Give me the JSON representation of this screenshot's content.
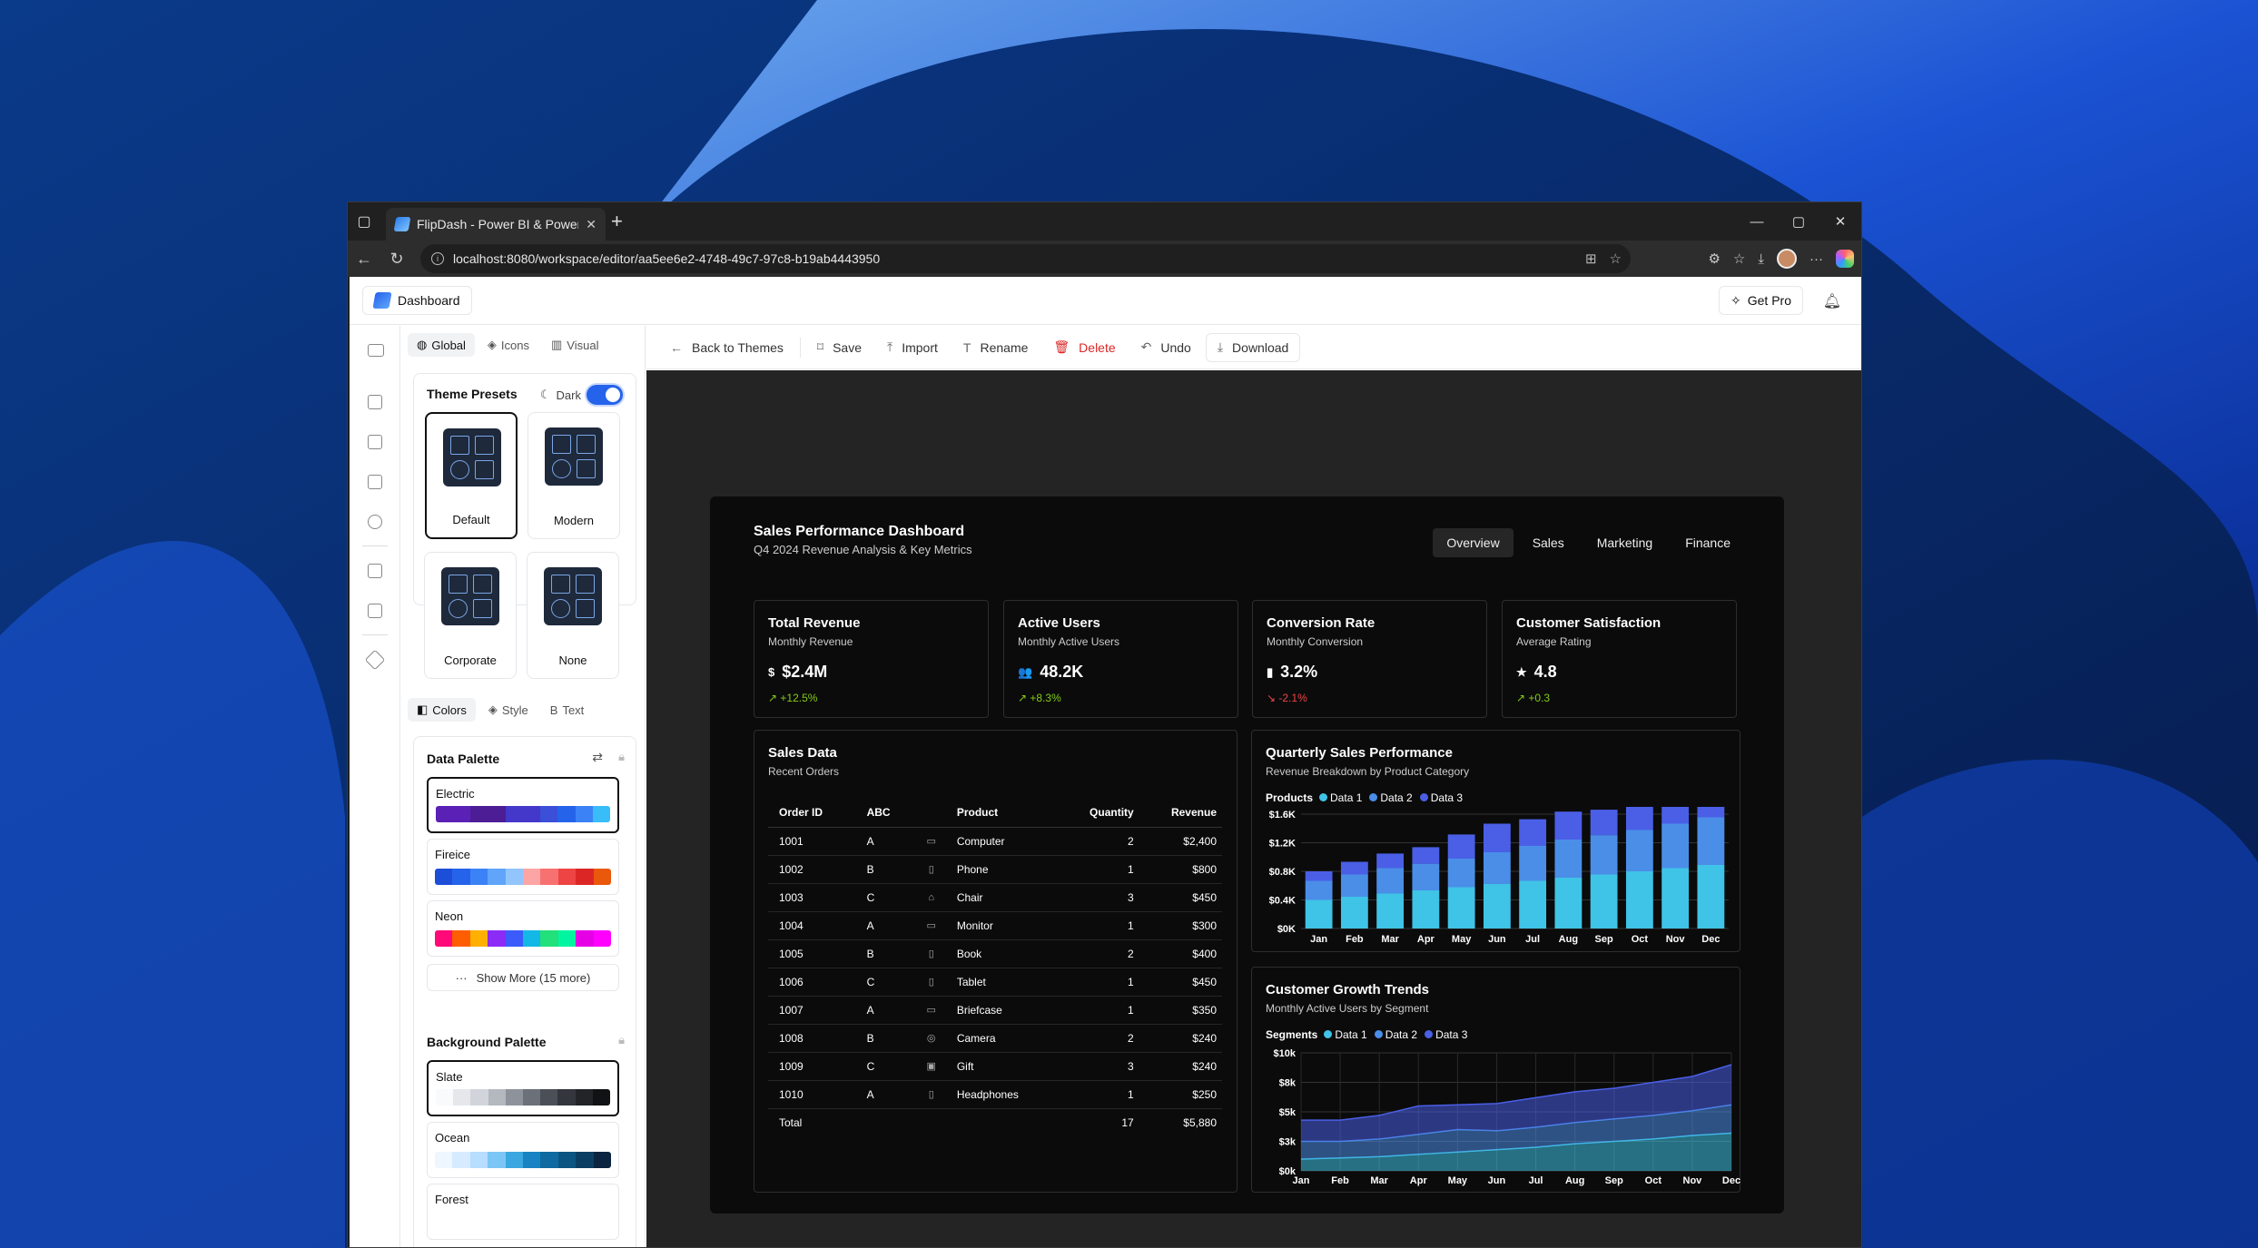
{
  "browser": {
    "tab_title": "FlipDash - Power BI & Power Apps",
    "url": "localhost:8080/workspace/editor/aa5ee6e2-4748-49c7-97c8-b19ab4443950"
  },
  "header": {
    "brand": "Dashboard",
    "get_pro": "Get Pro"
  },
  "panel": {
    "tabs": [
      "Global",
      "Icons",
      "Visual"
    ],
    "theme_presets_title": "Theme Presets",
    "dark_label": "Dark",
    "presets": [
      "Default",
      "Modern",
      "Corporate",
      "None"
    ],
    "sub_tabs": [
      "Colors",
      "Style",
      "Text"
    ],
    "data_palette_title": "Data Palette",
    "palettes": [
      {
        "name": "Electric",
        "colors": [
          "#5b21b6",
          "#5b21b6",
          "#4c1d95",
          "#4c1d95",
          "#4338ca",
          "#4338ca",
          "#3b4fd8",
          "#2563eb",
          "#3b82f6",
          "#38bdf8"
        ]
      },
      {
        "name": "Fireice",
        "colors": [
          "#1d4ed8",
          "#2563eb",
          "#3b82f6",
          "#60a5fa",
          "#93c5fd",
          "#fca5a5",
          "#f87171",
          "#ef4444",
          "#dc2626",
          "#ea580c"
        ]
      },
      {
        "name": "Neon",
        "colors": [
          "#ff0a78",
          "#ff5e00",
          "#ffb000",
          "#8b2bf5",
          "#3b5bfa",
          "#14b8e6",
          "#22e07a",
          "#00f5a0",
          "#e600e6",
          "#ff00ff"
        ]
      }
    ],
    "show_more": "Show More (15 more)",
    "bg_palette_title": "Background Palette",
    "bg_palettes": [
      {
        "name": "Slate",
        "colors": [
          "#f8fafc",
          "#e5e7eb",
          "#d1d5db",
          "#b4b8bf",
          "#8e939b",
          "#6b7079",
          "#4b5058",
          "#33373d",
          "#222427",
          "#111214"
        ]
      },
      {
        "name": "Ocean",
        "colors": [
          "#eef6ff",
          "#d6ebff",
          "#b7ddff",
          "#7cc6f5",
          "#3ba7e0",
          "#1783c2",
          "#0e6aa0",
          "#0b5583",
          "#0a3f63",
          "#0b2440"
        ]
      }
    ],
    "forest_label": "Forest"
  },
  "toolbar": {
    "back": "Back to Themes",
    "save": "Save",
    "import": "Import",
    "rename": "Rename",
    "delete": "Delete",
    "undo": "Undo",
    "download": "Download"
  },
  "dashboard": {
    "title": "Sales Performance Dashboard",
    "subtitle": "Q4 2024 Revenue Analysis & Key Metrics",
    "tabs": [
      "Overview",
      "Sales",
      "Marketing",
      "Finance"
    ],
    "kpis": [
      {
        "title": "Total Revenue",
        "sub": "Monthly Revenue",
        "icon": "dollar-icon",
        "glyph": "$",
        "value": "$2.4M",
        "change": "↗ +12.5%",
        "trend": "up"
      },
      {
        "title": "Active Users",
        "sub": "Monthly Active Users",
        "icon": "users-icon",
        "glyph": "👥",
        "value": "48.2K",
        "change": "↗ +8.3%",
        "trend": "up"
      },
      {
        "title": "Conversion Rate",
        "sub": "Monthly Conversion",
        "icon": "bar-chart-icon",
        "glyph": "▮",
        "value": "3.2%",
        "change": "↘ -2.1%",
        "trend": "down"
      },
      {
        "title": "Customer Satisfaction",
        "sub": "Average Rating",
        "icon": "star-icon",
        "glyph": "★",
        "value": "4.8",
        "change": "↗ +0.3",
        "trend": "up"
      }
    ],
    "sales": {
      "title": "Sales Data",
      "sub": "Recent Orders",
      "columns": [
        "Order ID",
        "ABC",
        "",
        "Product",
        "Quantity",
        "Revenue"
      ],
      "rows": [
        [
          "1001",
          "A",
          "▭",
          "Computer",
          "2",
          "$2,400"
        ],
        [
          "1002",
          "B",
          "▯",
          "Phone",
          "1",
          "$800"
        ],
        [
          "1003",
          "C",
          "⌂",
          "Chair",
          "3",
          "$450"
        ],
        [
          "1004",
          "A",
          "▭",
          "Monitor",
          "1",
          "$300"
        ],
        [
          "1005",
          "B",
          "▯",
          "Book",
          "2",
          "$400"
        ],
        [
          "1006",
          "C",
          "▯",
          "Tablet",
          "1",
          "$450"
        ],
        [
          "1007",
          "A",
          "▭",
          "Briefcase",
          "1",
          "$350"
        ],
        [
          "1008",
          "B",
          "◎",
          "Camera",
          "2",
          "$240"
        ],
        [
          "1009",
          "C",
          "▣",
          "Gift",
          "3",
          "$240"
        ],
        [
          "1010",
          "A",
          "▯",
          "Headphones",
          "1",
          "$250"
        ]
      ],
      "total": [
        "Total",
        "",
        "",
        "",
        "17",
        "$5,880"
      ]
    },
    "colors": {
      "data1": "#3fc3e6",
      "data2": "#4a8ee8",
      "data3": "#4a5fe6"
    },
    "quarterly": {
      "title": "Quarterly Sales Performance",
      "sub": "Revenue Breakdown by Product Category",
      "legend_title": "Products"
    },
    "growth": {
      "title": "Customer Growth Trends",
      "sub": "Monthly Active Users by Segment",
      "legend_title": "Segments"
    }
  },
  "chart_data": [
    {
      "type": "bar",
      "stacked": true,
      "title": "Quarterly Sales Performance",
      "categories": [
        "Jan",
        "Feb",
        "Mar",
        "Apr",
        "May",
        "Jun",
        "Jul",
        "Aug",
        "Sep",
        "Oct",
        "Nov",
        "Dec"
      ],
      "series": [
        {
          "name": "Data 1",
          "values": [
            450,
            500,
            550,
            600,
            650,
            700,
            750,
            800,
            850,
            900,
            950,
            1000
          ]
        },
        {
          "name": "Data 2",
          "values": [
            300,
            350,
            400,
            420,
            450,
            500,
            550,
            600,
            620,
            650,
            700,
            750
          ]
        },
        {
          "name": "Data 3",
          "values": [
            150,
            200,
            230,
            260,
            380,
            450,
            420,
            440,
            400,
            480,
            480,
            520
          ]
        }
      ],
      "yticks": [
        "$0K",
        "$0.4K",
        "$0.8K",
        "$1.2K",
        "$1.6K"
      ],
      "ylim": [
        0,
        1800
      ],
      "grid": true,
      "legend": "top-left"
    },
    {
      "type": "area",
      "stacked": true,
      "title": "Customer Growth Trends",
      "x": [
        "Jan",
        "Feb",
        "Mar",
        "Apr",
        "May",
        "Jun",
        "Jul",
        "Aug",
        "Sep",
        "Oct",
        "Nov",
        "Dec"
      ],
      "series": [
        {
          "name": "Data 1",
          "values": [
            1000,
            1100,
            1200,
            1400,
            1600,
            1800,
            2000,
            2300,
            2500,
            2700,
            3000,
            3200
          ]
        },
        {
          "name": "Data 2",
          "values": [
            1500,
            1400,
            1500,
            1700,
            1900,
            1600,
            1700,
            1800,
            1900,
            2000,
            2100,
            2400
          ]
        },
        {
          "name": "Data 3",
          "values": [
            1800,
            1800,
            2000,
            2400,
            2100,
            2300,
            2500,
            2600,
            2600,
            2800,
            2900,
            3400
          ]
        }
      ],
      "yticks": [
        "$0k",
        "$3k",
        "$5k",
        "$8k",
        "$10k"
      ],
      "ylim": [
        0,
        10000
      ],
      "grid": true,
      "legend": "top-left"
    }
  ]
}
